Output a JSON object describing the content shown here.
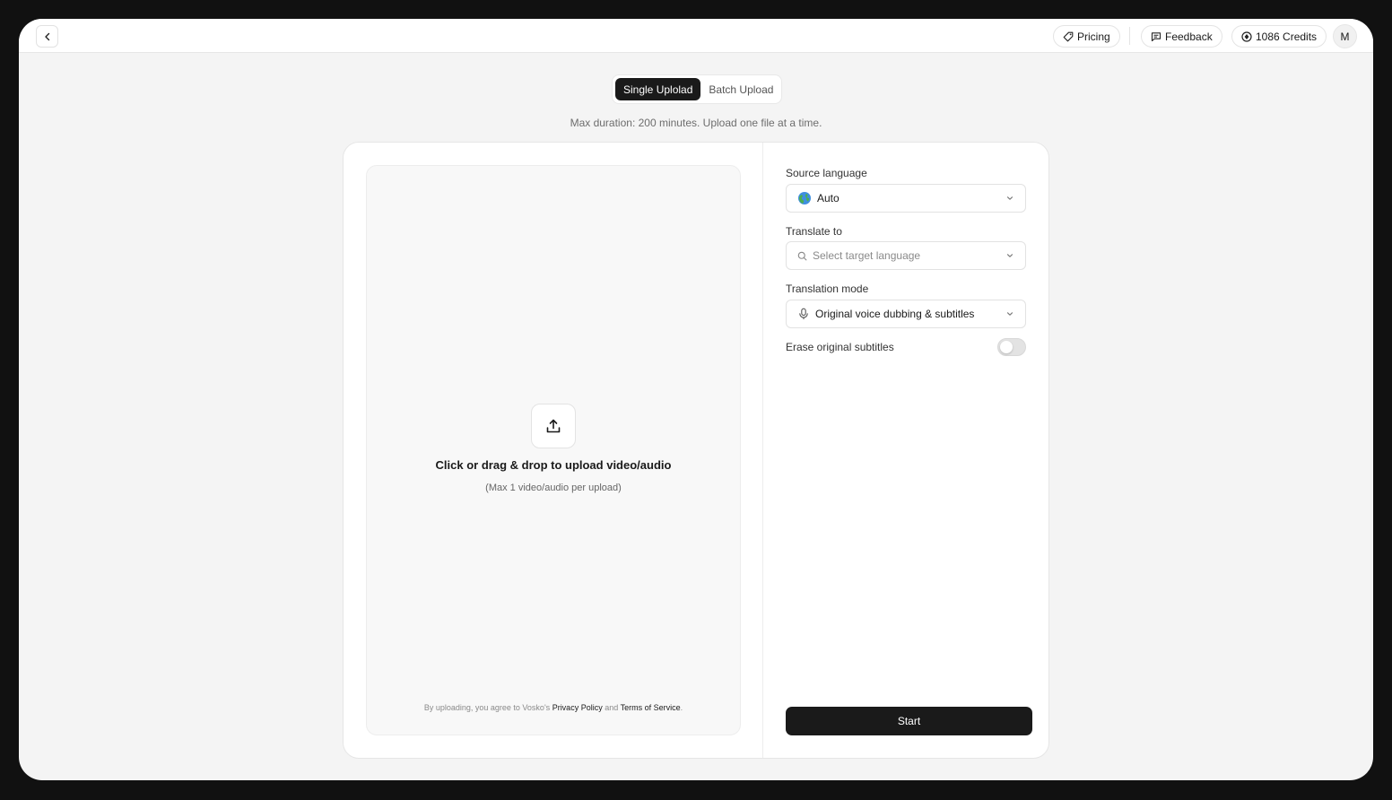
{
  "topbar": {
    "pricing_label": "Pricing",
    "feedback_label": "Feedback",
    "credits_label": "1086 Credits",
    "avatar_initial": "M"
  },
  "upload_mode": {
    "tabs": [
      {
        "label": "Single Uplolad",
        "active": true
      },
      {
        "label": "Batch Upload",
        "active": false
      }
    ],
    "note": "Max duration: 200 minutes. Upload one file at a time."
  },
  "dropzone": {
    "title": "Click or drag & drop to upload video/audio",
    "subtitle": "(Max 1 video/audio per upload)",
    "legal_prefix": "By uploading, you agree to Vosko's",
    "privacy_link": "Privacy Policy",
    "legal_and": "and",
    "terms_link": "Terms of Service",
    "legal_suffix": "."
  },
  "settings": {
    "source_language_label": "Source language",
    "source_language_value": "Auto",
    "translate_to_label": "Translate to",
    "translate_to_placeholder": "Select target language",
    "translation_mode_label": "Translation mode",
    "translation_mode_value": "Original voice dubbing & subtitles",
    "erase_subtitles_label": "Erase original subtitles",
    "erase_subtitles_on": false,
    "start_label": "Start"
  },
  "icons": {
    "back": "chevron-left-icon",
    "pricing": "tag-icon",
    "feedback": "message-icon",
    "credits": "coin-icon",
    "upload": "upload-icon",
    "source_language": "globe-icon",
    "search": "search-icon",
    "mode": "microphone-icon",
    "dropdown": "chevron-down-icon"
  }
}
